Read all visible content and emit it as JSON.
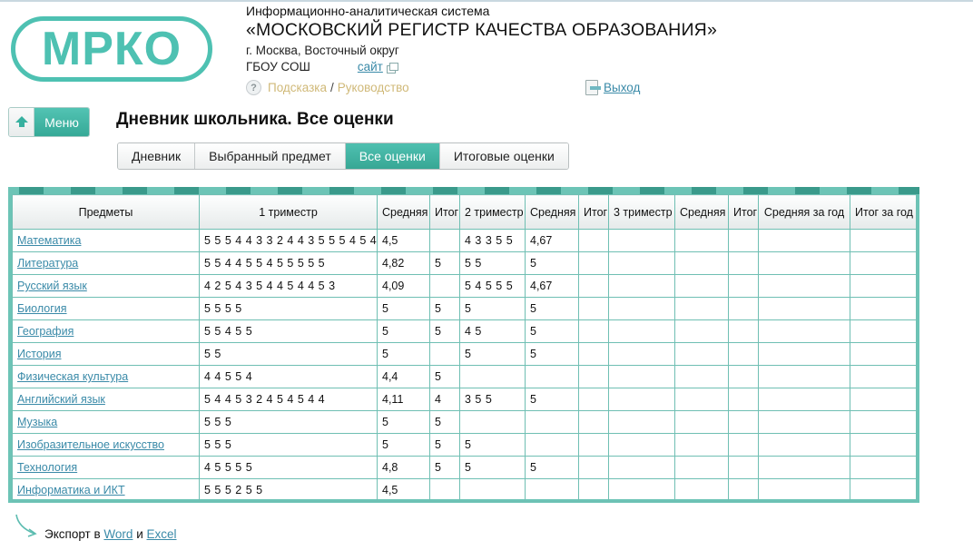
{
  "logo": {
    "text": "МРКО"
  },
  "header": {
    "subtitle": "Информационно-аналитическая система",
    "title": "«МОСКОВСКИЙ РЕГИСТР КАЧЕСТВА ОБРАЗОВАНИЯ»",
    "region": "г. Москва, Восточный округ",
    "school": "ГБОУ СОШ",
    "site_link": "сайт",
    "help_icon": "?",
    "hint_link": "Подсказка",
    "separator": "/",
    "guide_link": "Руководство",
    "logout_link": "Выход"
  },
  "menu_button": {
    "label": "Меню"
  },
  "page_title": "Дневник школьника. Все оценки",
  "tabs": [
    {
      "label": "Дневник",
      "active": false
    },
    {
      "label": "Выбранный предмет",
      "active": false
    },
    {
      "label": "Все оценки",
      "active": true
    },
    {
      "label": "Итоговые оценки",
      "active": false
    }
  ],
  "table": {
    "columns": [
      "Предметы",
      "1 триместр",
      "Средняя",
      "Итог",
      "2 триместр",
      "Средняя",
      "Итог",
      "3 триместр",
      "Средняя",
      "Итог",
      "Средняя за год",
      "Итог за год"
    ],
    "rows": [
      [
        "Математика",
        "5 5 5 4 4 3 3 2 4 4 3 5 5 5 4 5 4",
        "4,5",
        "",
        "4 3 3 5 5",
        "4,67",
        "",
        "",
        "",
        "",
        "",
        ""
      ],
      [
        "Литература",
        "5 5 4 4 5 5 4 5 5 5 5 5",
        "4,82",
        "5",
        "5 5",
        "5",
        "",
        "",
        "",
        "",
        "",
        ""
      ],
      [
        "Русский язык",
        "4 2 5 4 3 5 4 4 5 4 4 5 3",
        "4,09",
        "",
        "5 4 5 5 5",
        "4,67",
        "",
        "",
        "",
        "",
        "",
        ""
      ],
      [
        "Биология",
        "5 5 5 5",
        "5",
        "5",
        "5",
        "5",
        "",
        "",
        "",
        "",
        "",
        ""
      ],
      [
        "География",
        "5 5 4 5 5",
        "5",
        "5",
        "4 5",
        "5",
        "",
        "",
        "",
        "",
        "",
        ""
      ],
      [
        "История",
        "5 5",
        "5",
        "",
        "5",
        "5",
        "",
        "",
        "",
        "",
        "",
        ""
      ],
      [
        "Физическая культура",
        "4 4 5 5 4",
        "4,4",
        "5",
        "",
        "",
        "",
        "",
        "",
        "",
        "",
        ""
      ],
      [
        "Английский язык",
        "5 4 4 5 3 2 4 5 4 5 4 4",
        "4,11",
        "4",
        "3 5 5",
        "5",
        "",
        "",
        "",
        "",
        "",
        ""
      ],
      [
        "Музыка",
        "5 5 5",
        "5",
        "5",
        "",
        "",
        "",
        "",
        "",
        "",
        "",
        ""
      ],
      [
        "Изобразительное искусство",
        "5 5 5",
        "5",
        "5",
        "5",
        "",
        "",
        "",
        "",
        "",
        "",
        ""
      ],
      [
        "Технология",
        "4 5 5 5 5",
        "4,8",
        "5",
        "5",
        "5",
        "",
        "",
        "",
        "",
        "",
        ""
      ],
      [
        "Информатика и ИКТ",
        "5 5 5 2 5 5",
        "4,5",
        "",
        "",
        "",
        "",
        "",
        "",
        "",
        "",
        ""
      ]
    ]
  },
  "export": {
    "prefix": "Экспорт в",
    "word_link": "Word",
    "conj": "и",
    "excel_link": "Excel"
  },
  "colors": {
    "accent": "#4ec1b2",
    "link": "#3a8aa8",
    "hint": "#d0b978",
    "table_border": "#6fbfb3"
  }
}
